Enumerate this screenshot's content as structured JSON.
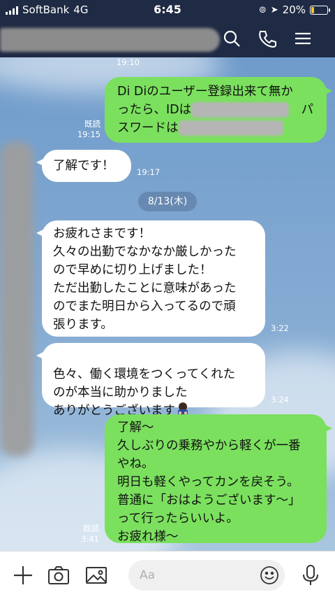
{
  "status": {
    "carrier": "SoftBank",
    "network": "4G",
    "time": "6:45",
    "battery": "20%",
    "battery_level": 0.2
  },
  "header": {
    "icons": [
      "search-icon",
      "phone-icon",
      "menu-icon"
    ]
  },
  "messages": [
    {
      "side": "mine",
      "time": "19:10",
      "text": ""
    },
    {
      "side": "mine",
      "line1": "Di Diのユーザー登録出来て無か",
      "line2a": "ったら、IDは",
      "line2b": "パ",
      "line3a": "スワード",
      "line3b": "は",
      "read": "既読",
      "time": "19:15"
    },
    {
      "side": "theirs",
      "text": "了解です！",
      "time": "19:17"
    },
    {
      "date": "8/13(木)"
    },
    {
      "side": "theirs",
      "text": "お疲れさまです！\n久々の出勤でなかなか厳しかった\nので早めに切り上げました！\nただ出勤したことに意味があった\nのでまた明日から入ってるので頑\n張ります。",
      "time": "3:22"
    },
    {
      "side": "theirs",
      "text": "色々、働く環境をつくってくれた\nのが本当に助かりました\nありがとうございます",
      "time": "3:24"
    },
    {
      "side": "mine",
      "text": "了解〜\n久しぶりの乗務やから軽くが一番\nやね。\n明日も軽くやってカンを戻そう。\n普通に「おはようございます〜」\nって行ったらいいよ。\nお疲れ様〜",
      "read": "既読",
      "time": "3:41"
    }
  ],
  "input": {
    "placeholder": "Aa"
  },
  "colors": {
    "header_bg": "#1f2a44",
    "my_bubble": "#7be05e",
    "their_bubble": "#ffffff",
    "battery": "#f5c518"
  }
}
